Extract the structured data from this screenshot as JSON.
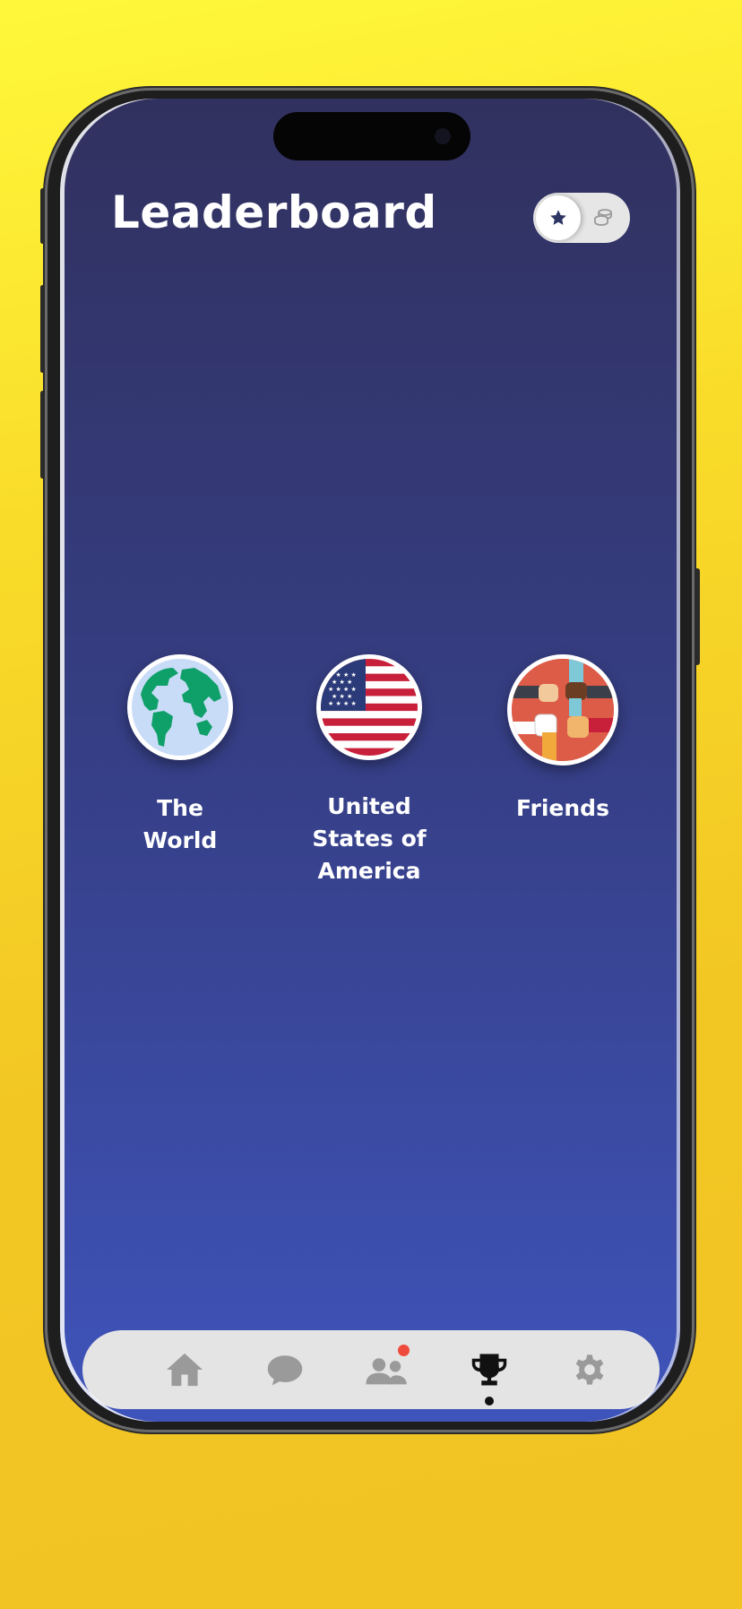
{
  "header": {
    "title": "Leaderboard"
  },
  "mode_toggle": {
    "selected": "stars",
    "options": [
      "star-icon",
      "coins-icon"
    ]
  },
  "regions": [
    {
      "label": "The World",
      "icon": "globe-icon"
    },
    {
      "label": "United States of America",
      "icon": "us-flag-icon"
    },
    {
      "label": "Friends",
      "icon": "friends-hands-icon"
    }
  ],
  "tab_bar": {
    "items": [
      {
        "icon": "home-icon",
        "active": false
      },
      {
        "icon": "chat-bubble-icon",
        "active": false
      },
      {
        "icon": "people-icon",
        "active": false,
        "notification": true
      },
      {
        "icon": "trophy-icon",
        "active": true
      },
      {
        "icon": "gear-icon",
        "active": false
      }
    ]
  },
  "colors": {
    "background_yellow": "#f2c623",
    "screen_top": "#31315f",
    "screen_bottom": "#3f54bb",
    "tabbar": "#e4e4e4",
    "tab_inactive": "#9a9a9a",
    "tab_active": "#111111",
    "notification": "#ef4b3c"
  }
}
